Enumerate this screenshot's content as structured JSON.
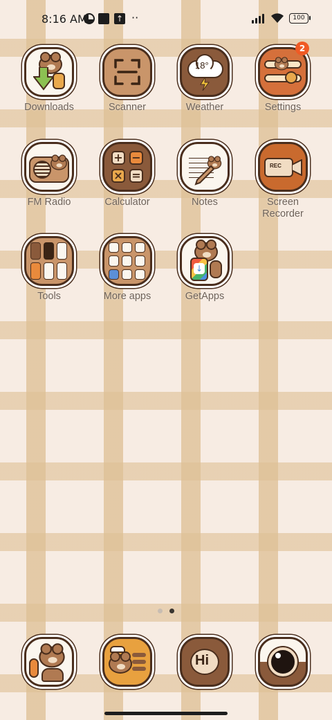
{
  "status_bar": {
    "time": "8:16 AM",
    "icons": [
      "data-saver-icon",
      "notification-square-icon",
      "upload-icon",
      "more-dots-icon",
      "signal-icon",
      "wifi-icon",
      "battery-icon"
    ],
    "more_dots": "··",
    "battery_level": "100"
  },
  "apps": [
    {
      "label": "Downloads",
      "icon": "downloads-icon"
    },
    {
      "label": "Scanner",
      "icon": "scanner-icon"
    },
    {
      "label": "Weather",
      "icon": "weather-icon",
      "temp": "18°"
    },
    {
      "label": "Settings",
      "icon": "settings-icon",
      "badge": "2"
    },
    {
      "label": "FM Radio",
      "icon": "radio-icon"
    },
    {
      "label": "Calculator",
      "icon": "calculator-icon"
    },
    {
      "label": "Notes",
      "icon": "notes-icon"
    },
    {
      "label": "Screen Recorder",
      "label_line1": "Screen",
      "label_line2": "Recorder",
      "icon": "screen-recorder-icon",
      "rec": "REC"
    },
    {
      "label": "Tools",
      "icon": "tools-folder-icon"
    },
    {
      "label": "More apps",
      "icon": "more-apps-folder-icon"
    },
    {
      "label": "GetApps",
      "icon": "getapps-icon"
    }
  ],
  "pager": {
    "pages": 2,
    "current": 2
  },
  "dock": [
    {
      "icon": "phone-icon"
    },
    {
      "icon": "messages-icon"
    },
    {
      "icon": "hi-chat-icon",
      "text": "Hi"
    },
    {
      "icon": "camera-icon"
    }
  ],
  "colors": {
    "wallpaper": "#f7ece3",
    "plaid": "#dec096",
    "icon_outline": "#4a2e1d",
    "badge": "#f05a24",
    "label": "#6e6259"
  }
}
